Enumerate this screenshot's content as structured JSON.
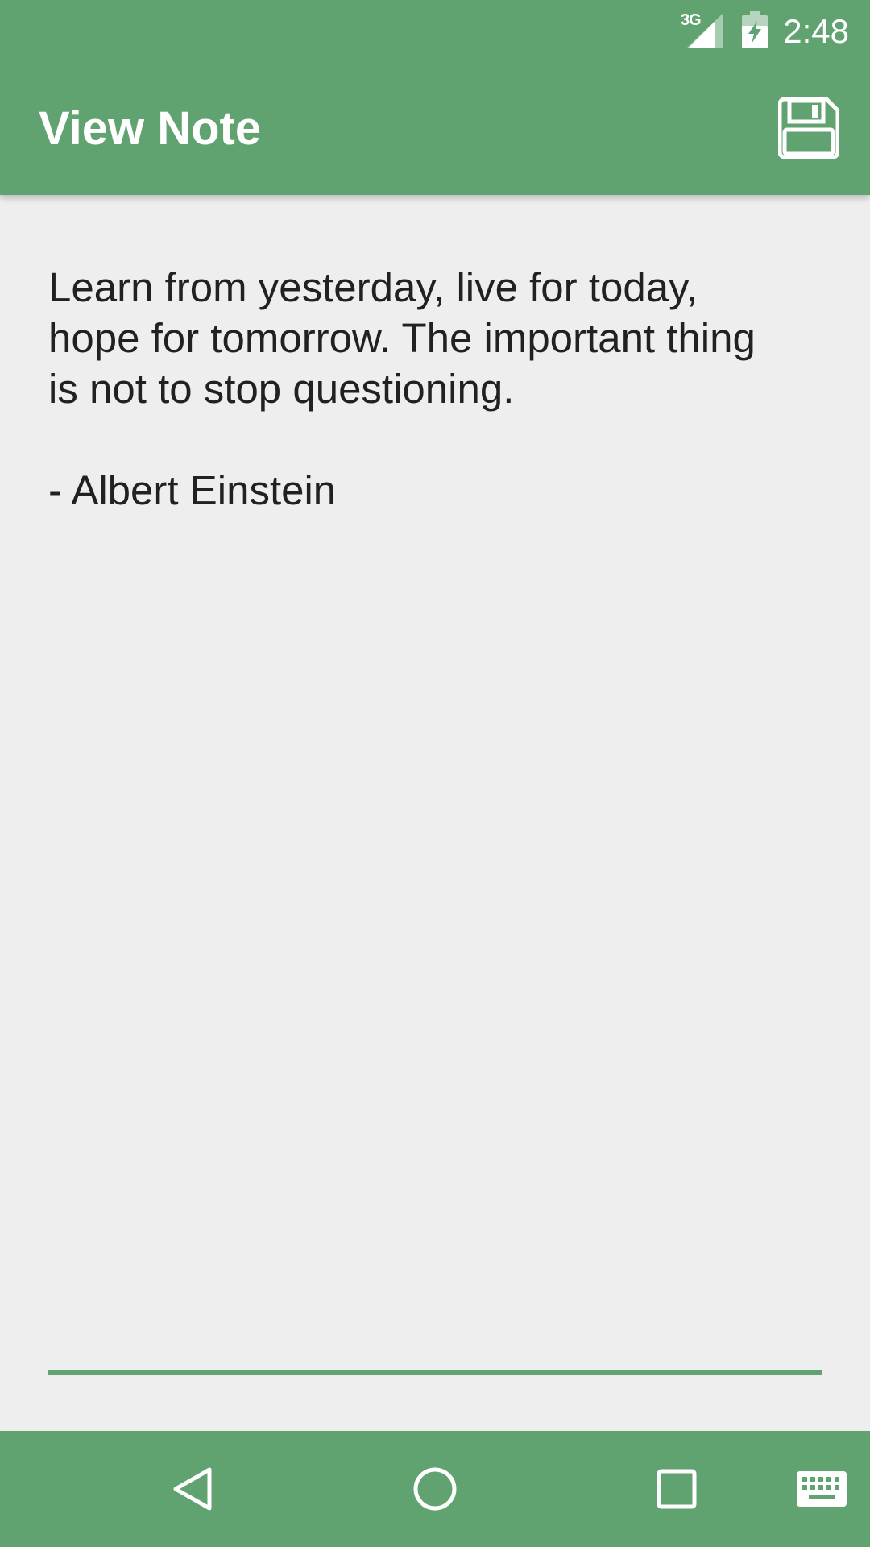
{
  "status_bar": {
    "network_label": "3G",
    "time": "2:48",
    "icons": [
      "signal-icon",
      "battery-charging-icon"
    ]
  },
  "app_bar": {
    "title": "View Note",
    "action_icon": "save-icon"
  },
  "note": {
    "text": "Learn from yesterday, live for today,\nhope for tomorrow. The important thing\nis not to stop questioning.\n\n- Albert Einstein"
  },
  "nav_bar": {
    "icons": [
      "back-icon",
      "home-icon",
      "recents-icon",
      "keyboard-icon"
    ]
  },
  "colors": {
    "primary": "#61a370",
    "background": "#eeeeee",
    "text": "#212121"
  }
}
